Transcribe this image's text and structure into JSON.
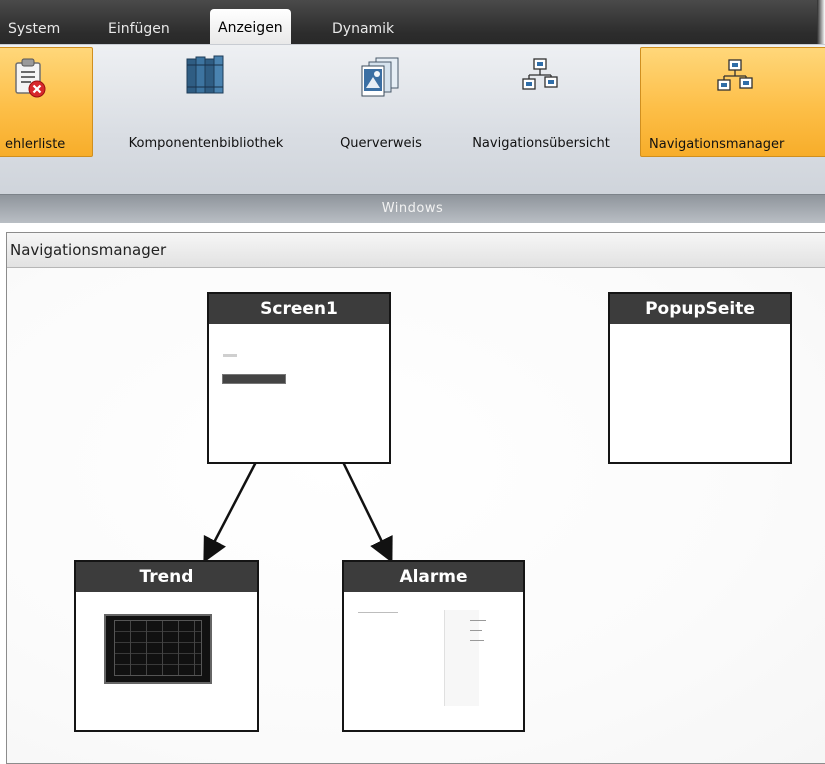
{
  "tabs": [
    {
      "label": "System",
      "active": false
    },
    {
      "label": "Einfügen",
      "active": false
    },
    {
      "label": "Anzeigen",
      "active": true
    },
    {
      "label": "Dynamik",
      "active": false
    }
  ],
  "ribbon": {
    "buttons": [
      {
        "label": "ehlerliste",
        "icon": "error-list-icon",
        "selected": true
      },
      {
        "label": "Komponentenbibliothek",
        "icon": "component-library-icon",
        "selected": false
      },
      {
        "label": "Querverweis",
        "icon": "cross-reference-icon",
        "selected": false
      },
      {
        "label": "Navigationsübersicht",
        "icon": "navigation-overview-icon",
        "selected": false
      },
      {
        "label": "Navigationsmanager",
        "icon": "navigation-manager-icon",
        "selected": true
      }
    ],
    "group_label": "Windows"
  },
  "panel": {
    "title": "Navigationsmanager"
  },
  "screens": {
    "screen1": "Screen1",
    "popup": "PopupSeite",
    "trend": "Trend",
    "alarme": "Alarme"
  },
  "colors": {
    "selected_button": "#fdbf48",
    "card_header": "#3c3c3c",
    "tabbar": "#2c2c2c"
  }
}
